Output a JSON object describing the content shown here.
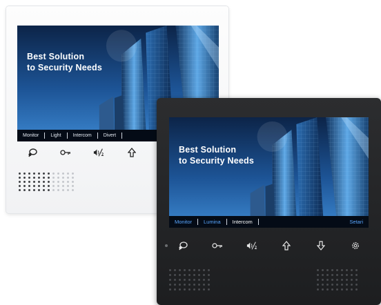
{
  "devices": {
    "white_panel": {
      "headline": "Best Solution\nto Security Needs",
      "menu": [
        "Monitor",
        "Light",
        "Intercom",
        "Divert",
        ""
      ],
      "buttons": [
        "talk-icon",
        "key-icon",
        "volume-icon",
        "up-arrow-icon"
      ],
      "color": "#f1f2f4"
    },
    "black_panel": {
      "headline": "Best Solution\nto Security Needs",
      "menu": [
        "Monitor",
        "Lumina",
        "Intercom",
        "",
        "",
        "Setari"
      ],
      "buttons": [
        "talk-icon",
        "key-icon",
        "volume-icon",
        "up-arrow-icon",
        "down-arrow-icon",
        "settings-icon"
      ],
      "color": "#1d1e20"
    }
  },
  "colors": {
    "sky_top": "#0c2448",
    "sky_bottom": "#2e79c6",
    "menu_text_black": "#5aa7ff"
  }
}
